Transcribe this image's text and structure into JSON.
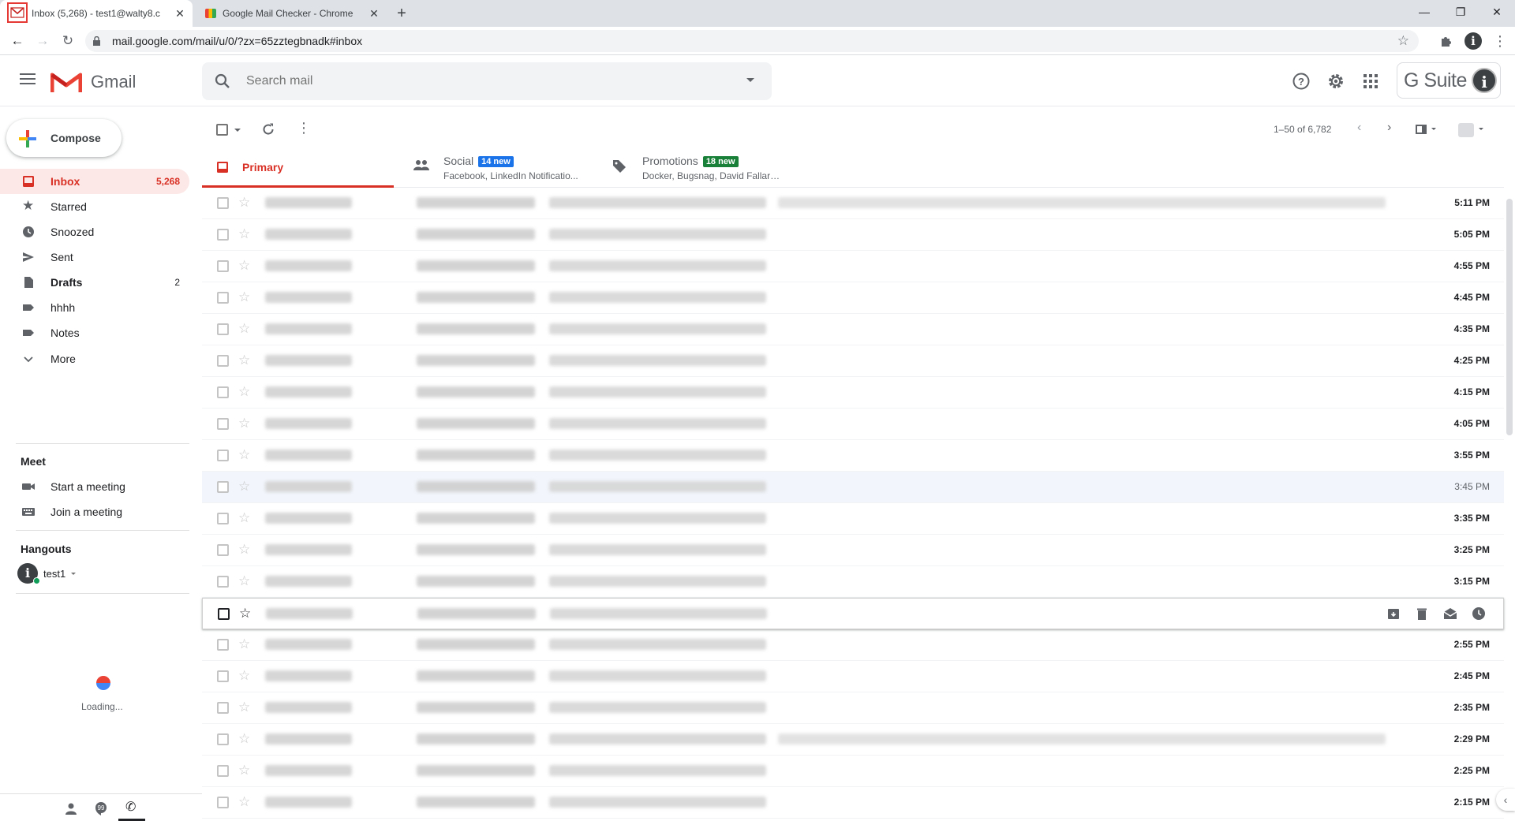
{
  "browser": {
    "tabs": [
      {
        "title": "Inbox (5,268) - test1@walty8.c",
        "active": true
      },
      {
        "title": "Google Mail Checker - Chrome",
        "active": false
      }
    ],
    "url": "mail.google.com/mail/u/0/?zx=65zztegbnadk#inbox"
  },
  "header": {
    "app_name": "Gmail",
    "search_placeholder": "Search mail",
    "suite_label": "G Suite"
  },
  "sidebar": {
    "compose_label": "Compose",
    "items": [
      {
        "label": "Inbox",
        "count": "5,268",
        "icon": "inbox-icon",
        "active": true
      },
      {
        "label": "Starred",
        "count": "",
        "icon": "star-icon"
      },
      {
        "label": "Snoozed",
        "count": "",
        "icon": "clock-icon"
      },
      {
        "label": "Sent",
        "count": "",
        "icon": "send-icon"
      },
      {
        "label": "Drafts",
        "count": "2",
        "icon": "file-icon",
        "bold": true
      },
      {
        "label": "hhhh",
        "count": "",
        "icon": "label-icon"
      },
      {
        "label": "Notes",
        "count": "",
        "icon": "label-icon"
      },
      {
        "label": "More",
        "count": "",
        "icon": "chevron-down-icon"
      }
    ],
    "meet": {
      "title": "Meet",
      "start": "Start a meeting",
      "join": "Join a meeting"
    },
    "hangouts": {
      "title": "Hangouts",
      "user": "test1",
      "loading": "Loading..."
    }
  },
  "toolbar": {
    "pagination": "1–50 of 6,782"
  },
  "category_tabs": [
    {
      "label": "Primary",
      "sub": "",
      "badge": "",
      "badge_color": "",
      "icon": "inbox-icon"
    },
    {
      "label": "Social",
      "sub": "Facebook, LinkedIn Notificatio...",
      "badge": "14 new",
      "badge_color": "#1a73e8",
      "icon": "people-icon"
    },
    {
      "label": "Promotions",
      "sub": "Docker, Bugsnag, David Fallarm...",
      "badge": "18 new",
      "badge_color": "#188038",
      "icon": "tag-icon"
    }
  ],
  "emails": [
    {
      "time": "5:11 PM",
      "read": false
    },
    {
      "time": "5:05 PM",
      "read": false
    },
    {
      "time": "4:55 PM",
      "read": false
    },
    {
      "time": "4:45 PM",
      "read": false
    },
    {
      "time": "4:35 PM",
      "read": false
    },
    {
      "time": "4:25 PM",
      "read": false
    },
    {
      "time": "4:15 PM",
      "read": false
    },
    {
      "time": "4:05 PM",
      "read": false
    },
    {
      "time": "3:55 PM",
      "read": false
    },
    {
      "time": "3:45 PM",
      "read": true
    },
    {
      "time": "3:35 PM",
      "read": false
    },
    {
      "time": "3:25 PM",
      "read": false
    },
    {
      "time": "3:15 PM",
      "read": false
    },
    {
      "time": "",
      "read": false,
      "hover": true
    },
    {
      "time": "2:55 PM",
      "read": false
    },
    {
      "time": "2:45 PM",
      "read": false
    },
    {
      "time": "2:35 PM",
      "read": false
    },
    {
      "time": "2:29 PM",
      "read": false
    },
    {
      "time": "2:25 PM",
      "read": false
    },
    {
      "time": "2:15 PM",
      "read": false
    }
  ]
}
